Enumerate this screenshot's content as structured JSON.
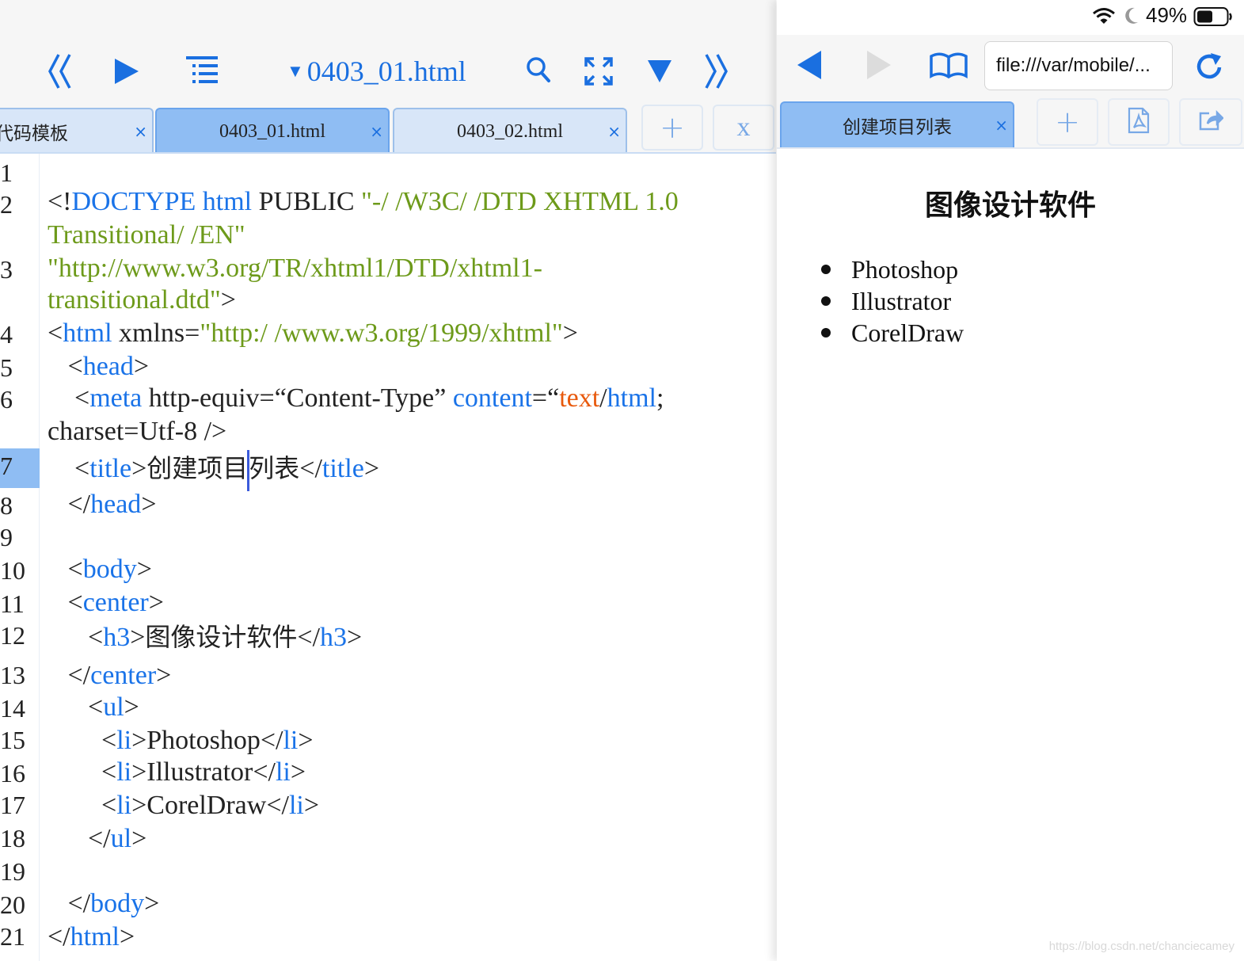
{
  "editor": {
    "file_title": "0403_01.html",
    "tabs": [
      {
        "label": "代码模板"
      },
      {
        "label": "0403_01.html",
        "active": true
      },
      {
        "label": "0403_02.html"
      }
    ],
    "tab_close_glyph": "×",
    "add_tab_glyph": "+",
    "close_all_label": "x",
    "active_line": 7,
    "line_numbers": [
      "1",
      "2",
      "3",
      "4",
      "5",
      "6",
      "7",
      "8",
      "9",
      "10",
      "11",
      "12",
      "13",
      "14",
      "15",
      "16",
      "17",
      "18",
      "19",
      "20",
      "21"
    ]
  },
  "browser": {
    "battery": "49%",
    "url": "file:///var/mobile/...",
    "tab_label": "创建项目列表",
    "tab_close_glyph": "×",
    "add_tab_glyph": "+",
    "page": {
      "heading": "图像设计软件",
      "items": [
        "Photoshop",
        "Illustrator",
        "CorelDraw"
      ]
    },
    "watermark": "https://blog.csdn.net/chanciecamey"
  },
  "colors": {
    "accent": "#1a6fe0",
    "tag": "#1a73e8",
    "string": "#6d9a1a",
    "keyword_orange": "#e8590c",
    "active_tab": "#8fbdf3",
    "inactive_tab": "#d8e6f8"
  },
  "icons": [
    "chevrons-left-icon",
    "play-icon",
    "outline-list-icon",
    "search-icon",
    "fullscreen-icon",
    "triangle-down-icon",
    "chevrons-right-icon",
    "wifi-icon",
    "moon-icon",
    "battery-icon",
    "back-arrow-icon",
    "forward-arrow-icon",
    "bookmarks-book-icon",
    "reload-icon",
    "pdf-icon",
    "share-icon"
  ]
}
